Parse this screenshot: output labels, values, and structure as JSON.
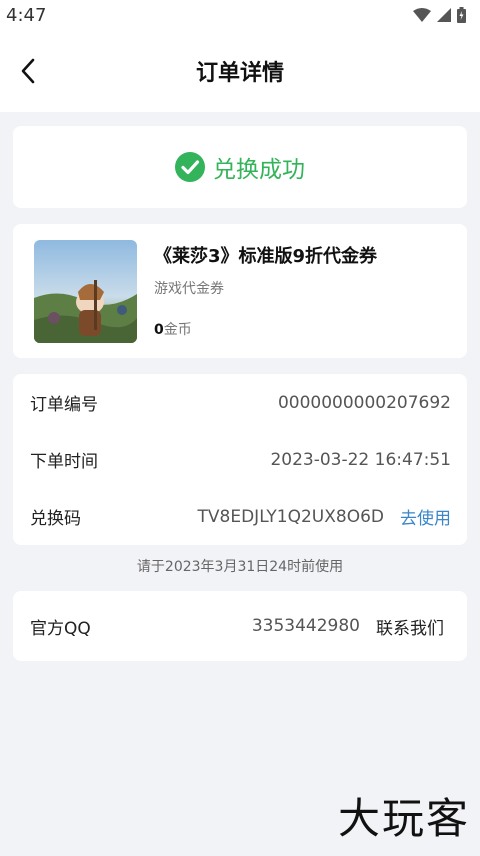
{
  "status_bar": {
    "time": "4:47"
  },
  "nav": {
    "title": "订单详情"
  },
  "success": {
    "text": "兑换成功",
    "color": "#33b35a"
  },
  "product": {
    "name": "《莱莎3》标准版9折代金券",
    "type": "游戏代金券",
    "price_value": "0",
    "price_unit": "金币"
  },
  "order": {
    "number_label": "订单编号",
    "number_value": "0000000000207692",
    "time_label": "下单时间",
    "time_value": "2023-03-22 16:47:51",
    "code_label": "兑换码",
    "code_value": "TV8EDJLY1Q2UX8O6D",
    "use_label": "去使用"
  },
  "note": "请于2023年3月31日24时前使用",
  "qq": {
    "label": "官方QQ",
    "value": "3353442980",
    "contact_label": "联系我们"
  },
  "watermark": "大玩客",
  "accent_link_color": "#3a86c8"
}
